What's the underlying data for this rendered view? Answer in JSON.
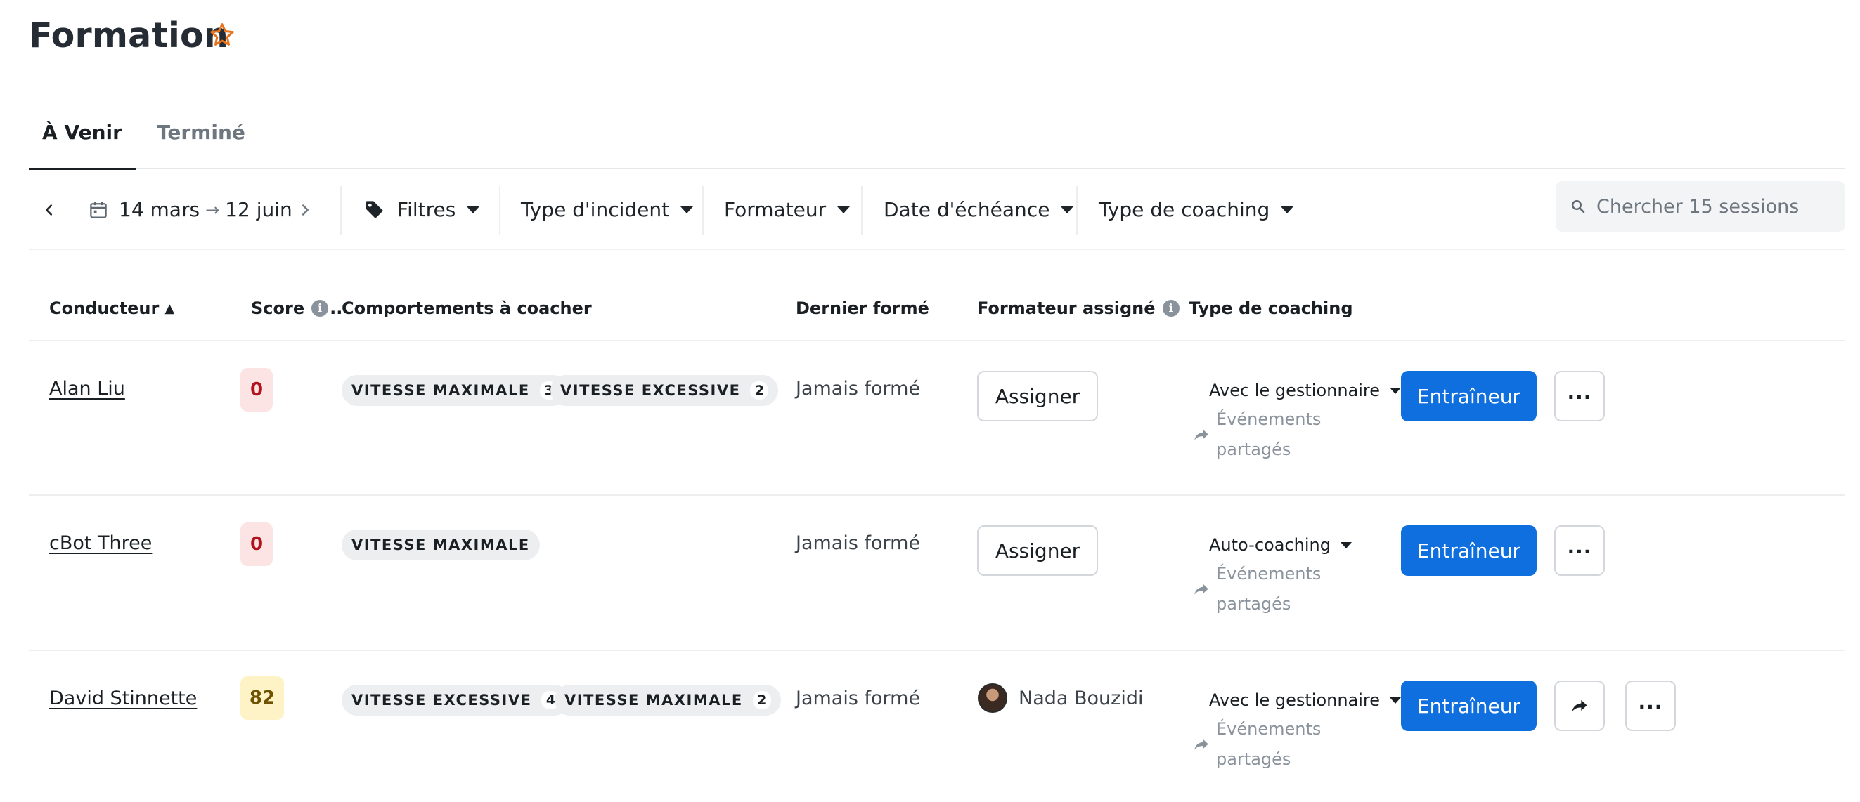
{
  "header": {
    "title": "Formation"
  },
  "tabs": [
    {
      "label": "À Venir",
      "active": true
    },
    {
      "label": "Terminé",
      "active": false
    }
  ],
  "filters": {
    "date_start": "14 mars",
    "date_arrow": "→",
    "date_end": "12 juin",
    "filters_label": "Filtres",
    "incident_type": "Type d'incident",
    "trainer": "Formateur",
    "due_date": "Date d'échéance",
    "coaching_type": "Type de coaching",
    "search_placeholder": "Chercher 15 sessions"
  },
  "table": {
    "headers": {
      "driver": "Conducteur",
      "sort_indicator": "▲",
      "score": "Score",
      "score_truncation": "..",
      "behaviors": "Comportements à coacher",
      "last_trained": "Dernier formé",
      "assigned_trainer": "Formateur assigné",
      "coaching_type": "Type de coaching"
    },
    "rows": [
      {
        "driver": "Alan Liu",
        "score": "0",
        "behaviors": [
          {
            "label": "VITESSE MAXIMALE",
            "count": "3"
          },
          {
            "label": "VITESSE EXCESSIVE",
            "count": "2"
          }
        ],
        "last_trained": "Jamais formé",
        "assign_label": "Assigner",
        "coaching_type": "Avec le gestionnaire",
        "shared_events": "Événements partagés",
        "coach_button": "Entraîneur"
      },
      {
        "driver": "cBot Three",
        "score": "0",
        "behaviors": [
          {
            "label": "VITESSE MAXIMALE"
          }
        ],
        "last_trained": "Jamais formé",
        "assign_label": "Assigner",
        "coaching_type": "Auto-coaching",
        "shared_events": "Événements partagés",
        "coach_button": "Entraîneur"
      },
      {
        "driver": "David Stinnette",
        "score": "82",
        "behaviors": [
          {
            "label": "VITESSE EXCESSIVE",
            "count": "4"
          },
          {
            "label": "VITESSE MAXIMALE",
            "count": "2"
          }
        ],
        "last_trained": "Jamais formé",
        "trainer_name": "Nada Bouzidi",
        "coaching_type": "Avec le gestionnaire",
        "shared_events": "Événements partagés",
        "coach_button": "Entraîneur"
      }
    ]
  },
  "colors": {
    "primary": "#0f6fde",
    "score_low_bg": "#fde4e4",
    "score_low_text": "#b1121b",
    "score_mid_bg": "#fdf3c7",
    "score_mid_text": "#6e5200",
    "star": "#e8731a"
  },
  "icons": [
    "star-outline-icon",
    "chevron-left-icon",
    "calendar-icon",
    "arrow-right-icon",
    "chevron-right-icon",
    "tag-icon",
    "caret-down-icon",
    "search-icon",
    "info-icon",
    "share-arrow-icon",
    "more-dots-icon",
    "avatar"
  ]
}
